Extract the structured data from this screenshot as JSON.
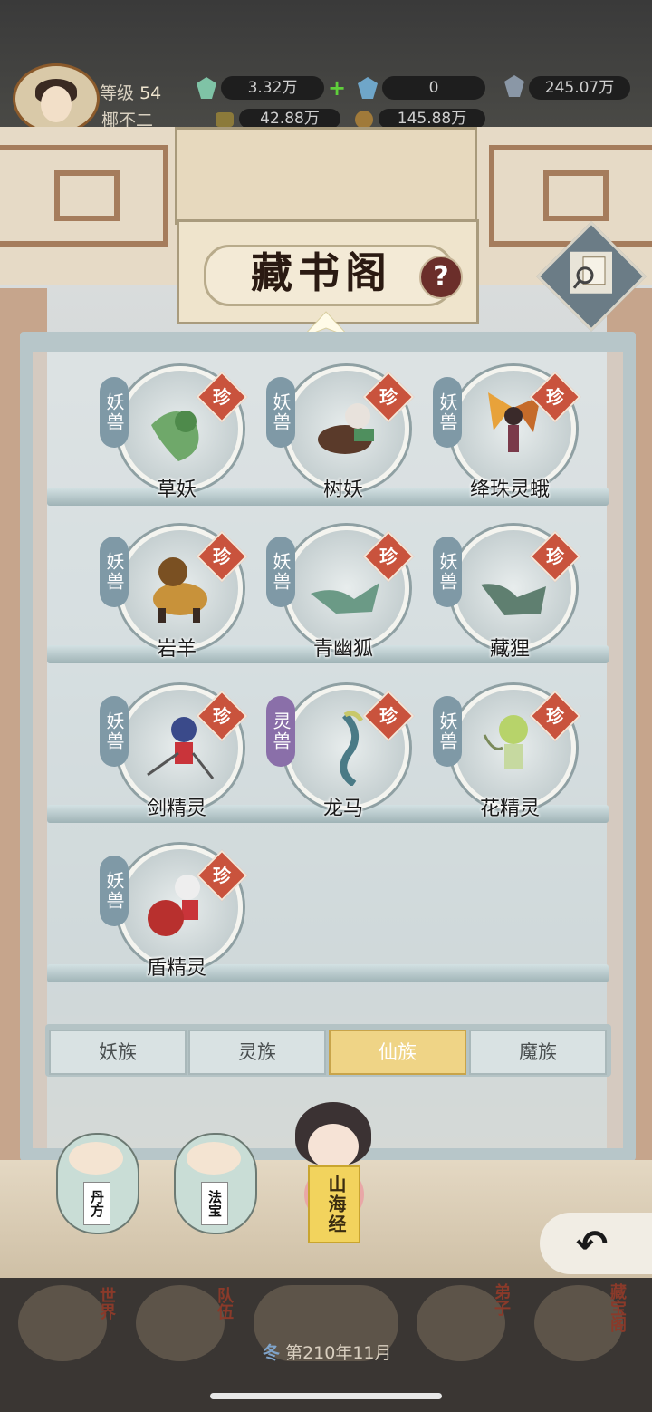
{
  "status": {
    "level_label": "等级",
    "level_value": "54",
    "player_name": "椰不二",
    "res1": "3.32万",
    "res2": "0",
    "res3": "245.07万",
    "res4": "42.88万",
    "res5": "145.88万"
  },
  "header": {
    "title": "藏书阁",
    "help": "?"
  },
  "creatures": [
    {
      "name": "草妖",
      "tag": "妖兽",
      "rarity": "珍"
    },
    {
      "name": "树妖",
      "tag": "妖兽",
      "rarity": "珍"
    },
    {
      "name": "绛珠灵蛾",
      "tag": "妖兽",
      "rarity": "珍"
    },
    {
      "name": "岩羊",
      "tag": "妖兽",
      "rarity": "珍"
    },
    {
      "name": "青幽狐",
      "tag": "妖兽",
      "rarity": "珍"
    },
    {
      "name": "藏狸",
      "tag": "妖兽",
      "rarity": "珍"
    },
    {
      "name": "剑精灵",
      "tag": "妖兽",
      "rarity": "珍"
    },
    {
      "name": "龙马",
      "tag": "灵兽",
      "rarity": "珍"
    },
    {
      "name": "花精灵",
      "tag": "妖兽",
      "rarity": "珍"
    },
    {
      "name": "盾精灵",
      "tag": "妖兽",
      "rarity": "珍"
    }
  ],
  "tabs": [
    "妖族",
    "灵族",
    "仙族",
    "魔族"
  ],
  "active_tab": "仙族",
  "bottom_books": {
    "danfang": "丹方",
    "fabao": "法宝",
    "shanhaijing": "山海经"
  },
  "nav": {
    "world": "世界",
    "team": "队伍",
    "disciple": "弟子",
    "treasure": "藏宝阁",
    "season": "冬",
    "date": "第210年11月"
  },
  "colors": {
    "accent": "#efd486",
    "rare": "#c9533d",
    "tag": "#7f99a6",
    "tag_ling": "#8a6fa9"
  }
}
